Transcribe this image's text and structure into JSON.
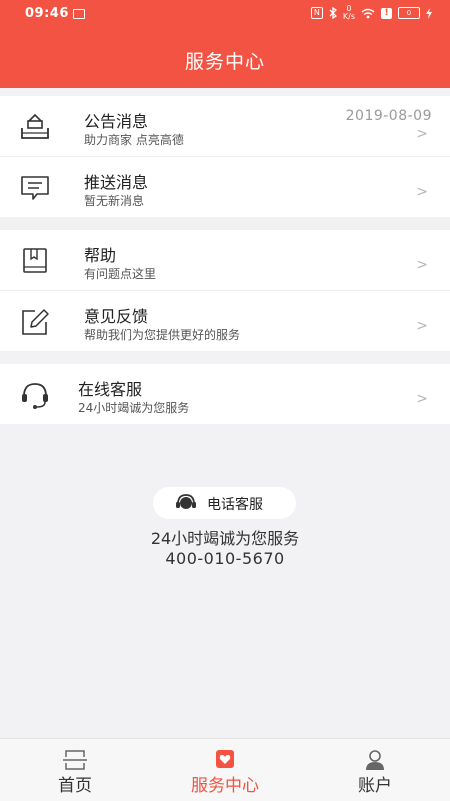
{
  "status_bar": {
    "time": "09:46",
    "network_speed_value": "0",
    "network_speed_unit": "K/s",
    "battery": "0"
  },
  "header": {
    "title": "服务中心"
  },
  "messages": [
    {
      "icon": "announcement-board-icon",
      "title": "公告消息",
      "subtitle": "助力商家 点亮高德",
      "date": "2019-08-09"
    },
    {
      "icon": "message-bubble-icon",
      "title": "推送消息",
      "subtitle": "暂无新消息"
    }
  ],
  "support": [
    {
      "icon": "book-icon",
      "title": "帮助",
      "subtitle": "有问题点这里"
    },
    {
      "icon": "edit-icon",
      "title": "意见反馈",
      "subtitle": "帮助我们为您提供更好的服务"
    }
  ],
  "online_service": {
    "icon": "headset-icon",
    "title": "在线客服",
    "subtitle": "24小时竭诚为您服务"
  },
  "phone": {
    "button_label": "电话客服",
    "service_text": "24小时竭诚为您服务",
    "number": "400-010-5670"
  },
  "tabs": [
    {
      "label": "首页",
      "icon": "scan-home-icon",
      "active": false
    },
    {
      "label": "服务中心",
      "icon": "service-heart-icon",
      "active": true
    },
    {
      "label": "账户",
      "icon": "person-icon",
      "active": false
    }
  ],
  "colors": {
    "accent": "#f25342",
    "background": "#f2f2f4",
    "chevron": "#b5b5b5"
  }
}
